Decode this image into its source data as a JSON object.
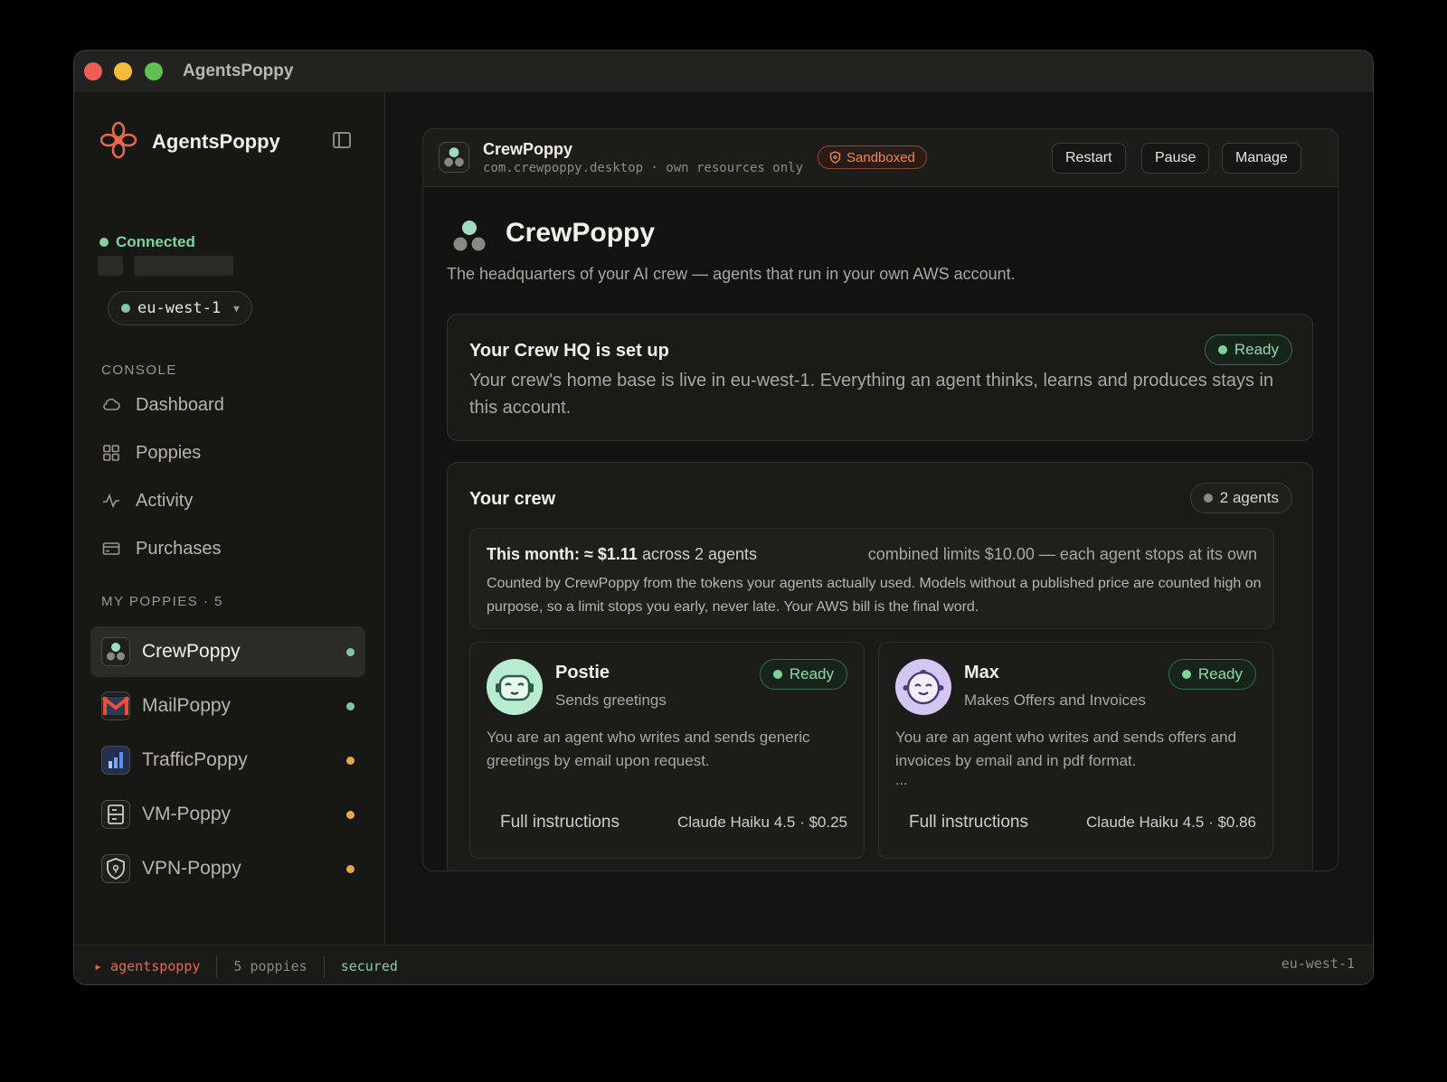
{
  "window": {
    "title": "AgentsPoppy"
  },
  "sidebar": {
    "brand": "AgentsPoppy",
    "status": "Connected",
    "region": "eu-west-1",
    "console_label": "CONSOLE",
    "nav": [
      {
        "label": "Dashboard",
        "icon": "cloud-icon"
      },
      {
        "label": "Poppies",
        "icon": "grid-icon"
      },
      {
        "label": "Activity",
        "icon": "activity-icon"
      },
      {
        "label": "Purchases",
        "icon": "card-icon"
      }
    ],
    "poppies_label": "MY POPPIES · 5",
    "poppies": [
      {
        "label": "CrewPoppy",
        "status_color": "#7fc998"
      },
      {
        "label": "MailPoppy",
        "status_color": "#7fc998"
      },
      {
        "label": "TrafficPoppy",
        "status_color": "#e9a94a"
      },
      {
        "label": "VM-Poppy",
        "status_color": "#e9a94a"
      },
      {
        "label": "VPN-Poppy",
        "status_color": "#e9a94a"
      }
    ]
  },
  "header": {
    "app_name": "CrewPoppy",
    "bundle": "com.crewpoppy.desktop · own resources only",
    "badge": "Sandboxed",
    "buttons": {
      "restart": "Restart",
      "pause": "Pause",
      "manage": "Manage"
    }
  },
  "hero": {
    "title": "CrewPoppy",
    "subtitle": "The headquarters of your AI crew — agents that run in your own AWS account."
  },
  "hq": {
    "title": "Your Crew HQ is set up",
    "status": "Ready",
    "body": "Your crew's home base is live in eu-west-1. Everything an agent thinks, learns and produces stays in this account."
  },
  "crew": {
    "title": "Your crew",
    "count": "2 agents",
    "month_label": "This month: ≈ $1.11",
    "month_across": "across 2 agents",
    "month_limits": "combined limits $10.00 — each agent stops at its own",
    "month_desc": "Counted by CrewPoppy from the tokens your agents actually used. Models without a published price are counted high on purpose, so a limit stops you early, never late. Your AWS bill is the final word.",
    "agents": [
      {
        "name": "Postie",
        "role": "Sends greetings",
        "status": "Ready",
        "desc": "You are an agent who writes and sends generic greetings by email upon request.",
        "ellipsis": "",
        "link": "Full instructions",
        "model": "Claude Haiku 4.5 · $0.25"
      },
      {
        "name": "Max",
        "role": "Makes Offers and Invoices",
        "status": "Ready",
        "desc": "You are an agent who writes and sends offers and invoices by email and in pdf format.",
        "ellipsis": "...",
        "link": "Full instructions",
        "model": "Claude Haiku 4.5 · $0.86"
      }
    ]
  },
  "statusbar": {
    "app": "▸ agentspoppy",
    "count": "5 poppies",
    "state": "secured",
    "region": "eu-west-1"
  },
  "colors": {
    "accent": "#e8674a",
    "ready": "#7fd49c",
    "warning": "#e9a94a"
  }
}
